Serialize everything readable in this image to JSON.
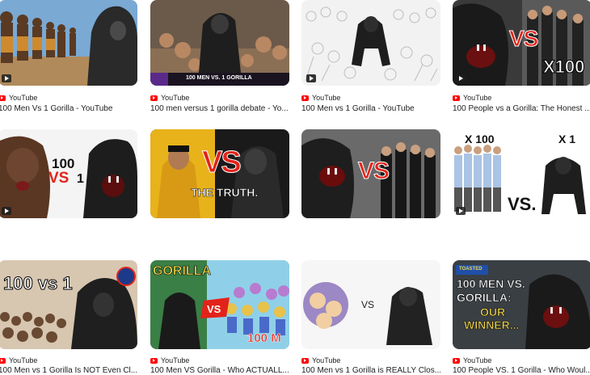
{
  "results": [
    {
      "source": "YouTube",
      "title": "100 Men Vs 1 Gorilla - YouTube"
    },
    {
      "source": "YouTube",
      "title": "100 men versus 1 gorilla debate - Yo...",
      "thumb_text": "100 MEN VS. 1 GORILLA"
    },
    {
      "source": "YouTube",
      "title": "100 Men vs 1 Gorilla - YouTube"
    },
    {
      "source": "YouTube",
      "title": "100 People vs a Gorilla: The Honest ...",
      "thumb_text": [
        "VS",
        "X100"
      ]
    },
    {
      "source": "YouTube",
      "title": "100 Men vs 1 Gorilla Is NOT Even Cl...",
      "thumb_text": [
        "100",
        "VS",
        "1"
      ]
    },
    {
      "source": "YouTube",
      "title": "100 Men VS Gorilla - Who ACTUALL...",
      "thumb_text": [
        "VS",
        "THE TRUTH."
      ]
    },
    {
      "source": "YouTube",
      "title": "100 Men vs 1 Gorilla is REALLY Clos...",
      "thumb_text": "VS"
    },
    {
      "source": "YouTube",
      "title": "100 People VS. 1 Gorilla - Who Woul...",
      "thumb_text": [
        "X 100",
        "X 1",
        "VS."
      ]
    },
    {
      "thumb_text": "100 vs 1"
    },
    {
      "thumb_text": [
        "GORILLA",
        "VS",
        "100 M"
      ]
    },
    {
      "thumb_text": "VS"
    },
    {
      "thumb_text": [
        "TOASTED",
        "100 MEN VS.",
        "GORILLA:",
        "OUR",
        "WINNER..."
      ]
    }
  ],
  "colors": {
    "youtube_red": "#ff0000",
    "vs_red": "#e2231a",
    "title_text": "#202124"
  }
}
